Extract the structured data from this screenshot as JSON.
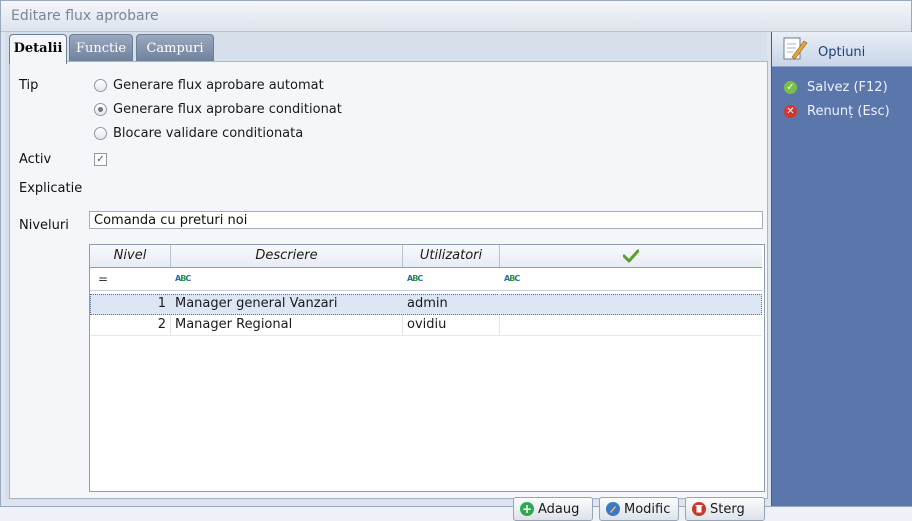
{
  "window": {
    "title": "Editare flux aprobare"
  },
  "tabs": [
    {
      "label": "Detalii"
    },
    {
      "label": "Functie"
    },
    {
      "label": "Campuri"
    }
  ],
  "form": {
    "tip_label": "Tip",
    "tip_options": [
      {
        "label": "Generare flux aprobare automat",
        "selected": false
      },
      {
        "label": "Generare flux aprobare conditionat",
        "selected": true
      },
      {
        "label": "Blocare validare conditionata",
        "selected": false
      }
    ],
    "activ_label": "Activ",
    "activ_checked": true,
    "activ_check_glyph": "✓",
    "explicatie_label": "Explicatie",
    "explicatie_value": "Comanda cu preturi noi",
    "niveluri_label": "Niveluri"
  },
  "grid": {
    "columns": [
      {
        "label": "Nivel"
      },
      {
        "label": "Descriere"
      },
      {
        "label": "Utilizatori"
      },
      {
        "label": "",
        "icon": "check-mark-icon"
      }
    ],
    "filter_nivel_glyph": "=",
    "rows": [
      {
        "nivel": "1",
        "descriere": "Manager general Vanzari",
        "utilizatori": "admin",
        "selected": true
      },
      {
        "nivel": "2",
        "descriere": "Manager Regional",
        "utilizatori": "ovidiu",
        "selected": false
      }
    ]
  },
  "buttons": {
    "add_label": "Adaug",
    "edit_label": "Modific",
    "delete_label": "Sterg"
  },
  "sidebar": {
    "title": "Optiuni",
    "items": [
      {
        "label": "Salvez (F12)",
        "icon": "check-circle-icon",
        "color": "#7bc043"
      },
      {
        "label": "Renunț (Esc)",
        "icon": "cancel-circle-icon",
        "color": "#d9342b"
      }
    ]
  },
  "colors": {
    "sidebar_bg": "#5a76ab",
    "accent_green": "#7bc043",
    "accent_red": "#d9342b"
  }
}
